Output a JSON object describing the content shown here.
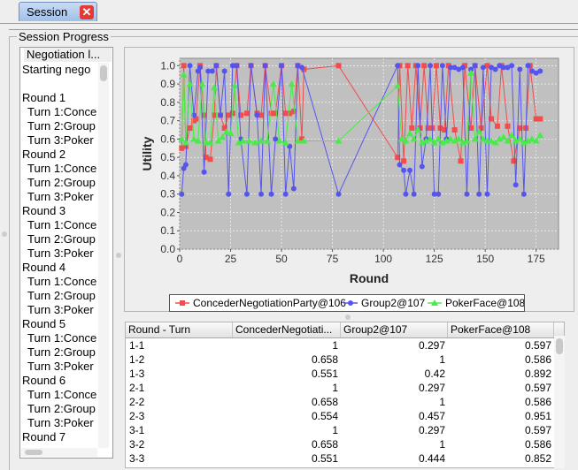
{
  "tab": {
    "label": "Session",
    "close_icon": "close-icon",
    "close_color": "#e53935"
  },
  "group": {
    "title": "Session Progress"
  },
  "negotiation_log": {
    "title": "Negotiation l...",
    "lines": [
      {
        "text": "Starting nego",
        "indent": false
      },
      {
        "text": "",
        "indent": false
      },
      {
        "text": "Round 1",
        "indent": false
      },
      {
        "text": "Turn 1:Conce",
        "indent": true
      },
      {
        "text": "Turn 2:Group",
        "indent": true
      },
      {
        "text": "Turn 3:Poker",
        "indent": true
      },
      {
        "text": "Round 2",
        "indent": false
      },
      {
        "text": "Turn 1:Conce",
        "indent": true
      },
      {
        "text": "Turn 2:Group",
        "indent": true
      },
      {
        "text": "Turn 3:Poker",
        "indent": true
      },
      {
        "text": "Round 3",
        "indent": false
      },
      {
        "text": "Turn 1:Conce",
        "indent": true
      },
      {
        "text": "Turn 2:Group",
        "indent": true
      },
      {
        "text": "Turn 3:Poker",
        "indent": true
      },
      {
        "text": "Round 4",
        "indent": false
      },
      {
        "text": "Turn 1:Conce",
        "indent": true
      },
      {
        "text": "Turn 2:Group",
        "indent": true
      },
      {
        "text": "Turn 3:Poker",
        "indent": true
      },
      {
        "text": "Round 5",
        "indent": false
      },
      {
        "text": "Turn 1:Conce",
        "indent": true
      },
      {
        "text": "Turn 2:Group",
        "indent": true
      },
      {
        "text": "Turn 3:Poker",
        "indent": true
      },
      {
        "text": "Round 6",
        "indent": false
      },
      {
        "text": "Turn 1:Conce",
        "indent": true
      },
      {
        "text": "Turn 2:Group",
        "indent": true
      },
      {
        "text": "Turn 3:Poker",
        "indent": true
      },
      {
        "text": "Round 7",
        "indent": false
      }
    ]
  },
  "chart_data": {
    "type": "line",
    "xlabel": "Round",
    "ylabel": "Utility",
    "xlim": [
      0,
      186
    ],
    "ylim": [
      0.0,
      1.04
    ],
    "x_ticks": [
      0,
      25,
      50,
      75,
      100,
      125,
      150,
      175
    ],
    "y_ticks": [
      0.0,
      0.1,
      0.2,
      0.3,
      0.4,
      0.5,
      0.6,
      0.7,
      0.8,
      0.9,
      1.0
    ],
    "plot_background": "#c0c0c0",
    "grid": true,
    "series": [
      {
        "name": "ConcederNegotiationParty@106",
        "color": "#f24c4c",
        "marker": "square",
        "x": [
          1,
          2,
          3,
          5,
          7,
          8,
          10,
          12,
          13,
          15,
          17,
          18,
          20,
          22,
          24,
          26,
          28,
          30,
          33,
          35,
          38,
          40,
          42,
          45,
          47,
          50,
          52,
          54,
          56,
          58,
          60,
          61,
          78,
          107,
          108,
          110,
          112,
          114,
          116,
          118,
          120,
          122,
          124,
          126,
          128,
          130,
          132,
          135,
          138,
          140,
          143,
          145,
          148,
          151,
          153,
          156,
          158,
          161,
          164,
          167,
          170,
          172,
          175,
          177
        ],
        "y": [
          0.55,
          1.0,
          0.56,
          0.66,
          0.7,
          0.71,
          1.0,
          0.73,
          0.5,
          0.49,
          0.73,
          1.0,
          0.73,
          0.66,
          0.73,
          0.74,
          1.0,
          0.73,
          0.74,
          1.0,
          0.74,
          0.73,
          1.0,
          0.74,
          0.74,
          1.0,
          0.74,
          0.74,
          0.75,
          1.0,
          0.6,
          0.98,
          1.0,
          0.5,
          1.0,
          0.48,
          1.0,
          0.66,
          1.0,
          0.66,
          1.0,
          0.66,
          0.66,
          1.0,
          0.66,
          0.65,
          1.0,
          0.65,
          0.48,
          1.0,
          0.66,
          1.0,
          0.66,
          1.0,
          0.71,
          0.67,
          1.0,
          0.67,
          0.48,
          0.66,
          0.66,
          1.0,
          0.71,
          0.71
        ]
      },
      {
        "name": "Group2@107",
        "color": "#5555ee",
        "marker": "circle",
        "x": [
          1,
          2,
          3,
          5,
          7,
          9,
          10,
          12,
          14,
          16,
          18,
          20,
          22,
          24,
          26,
          28,
          30,
          33,
          35,
          38,
          40,
          42,
          45,
          47,
          50,
          52,
          54,
          56,
          58,
          60,
          78,
          107,
          108,
          110,
          111,
          113,
          115,
          117,
          119,
          121,
          123,
          125,
          127,
          129,
          131,
          133,
          135,
          137,
          139,
          141,
          143,
          145,
          147,
          149,
          151,
          153,
          155,
          157,
          159,
          161,
          163,
          165,
          167,
          169,
          171,
          173,
          175,
          177
        ],
        "y": [
          0.3,
          0.44,
          0.46,
          1.0,
          0.73,
          0.97,
          0.99,
          0.42,
          0.97,
          0.97,
          1.0,
          0.73,
          0.97,
          0.3,
          1.0,
          1.0,
          0.6,
          0.3,
          1.0,
          0.73,
          0.3,
          1.0,
          0.3,
          0.6,
          1.0,
          0.3,
          0.56,
          0.33,
          1.0,
          0.99,
          0.3,
          1.0,
          0.46,
          0.43,
          0.3,
          0.43,
          0.3,
          1.0,
          0.45,
          0.6,
          1.0,
          0.3,
          0.3,
          1.0,
          0.6,
          0.99,
          0.99,
          0.98,
          0.99,
          0.3,
          0.98,
          1.0,
          0.3,
          0.99,
          0.3,
          0.99,
          0.98,
          1.0,
          0.99,
          0.99,
          1.0,
          0.35,
          0.98,
          0.3,
          1.0,
          0.97,
          0.96,
          0.97
        ]
      },
      {
        "name": "PokerFace@108",
        "color": "#44ee44",
        "marker": "triangle",
        "x": [
          1,
          2,
          3,
          5,
          7,
          9,
          11,
          13,
          15,
          17,
          19,
          21,
          23,
          25,
          27,
          29,
          31,
          34,
          37,
          40,
          43,
          46,
          49,
          52,
          55,
          58,
          61,
          78,
          107,
          109,
          111,
          113,
          115,
          117,
          119,
          121,
          123,
          125,
          127,
          129,
          131,
          133,
          135,
          137,
          139,
          141,
          143,
          145,
          147,
          149,
          151,
          153,
          155,
          157,
          159,
          161,
          163,
          165,
          167,
          169,
          171,
          173,
          175,
          177
        ],
        "y": [
          0.6,
          0.95,
          0.58,
          0.9,
          0.6,
          0.59,
          0.9,
          0.58,
          0.58,
          0.88,
          0.59,
          0.61,
          0.64,
          0.63,
          0.89,
          0.58,
          0.59,
          0.59,
          0.58,
          0.59,
          0.59,
          0.9,
          0.59,
          0.58,
          0.9,
          0.59,
          0.59,
          0.59,
          0.89,
          0.6,
          0.59,
          0.63,
          0.6,
          0.65,
          0.58,
          0.59,
          0.6,
          0.58,
          0.6,
          0.58,
          0.59,
          0.6,
          0.59,
          0.6,
          0.58,
          0.59,
          0.96,
          0.6,
          0.64,
          0.6,
          0.59,
          0.59,
          0.58,
          0.6,
          0.61,
          0.59,
          0.62,
          0.59,
          0.6,
          0.58,
          0.59,
          0.6,
          0.59,
          0.62
        ]
      }
    ],
    "legend": "bottom"
  },
  "table": {
    "headers": [
      "Round - Turn",
      "ConcederNegotiati...",
      "Group2@107",
      "PokerFace@108"
    ],
    "rows": [
      [
        "1-1",
        "1",
        "0.297",
        "0.597"
      ],
      [
        "1-2",
        "0.658",
        "1",
        "0.586"
      ],
      [
        "1-3",
        "0.551",
        "0.42",
        "0.892"
      ],
      [
        "2-1",
        "1",
        "0.297",
        "0.597"
      ],
      [
        "2-2",
        "0.658",
        "1",
        "0.586"
      ],
      [
        "2-3",
        "0.554",
        "0.457",
        "0.951"
      ],
      [
        "3-1",
        "1",
        "0.297",
        "0.597"
      ],
      [
        "3-2",
        "0.658",
        "1",
        "0.586"
      ],
      [
        "3-3",
        "0.551",
        "0.444",
        "0.852"
      ]
    ]
  }
}
